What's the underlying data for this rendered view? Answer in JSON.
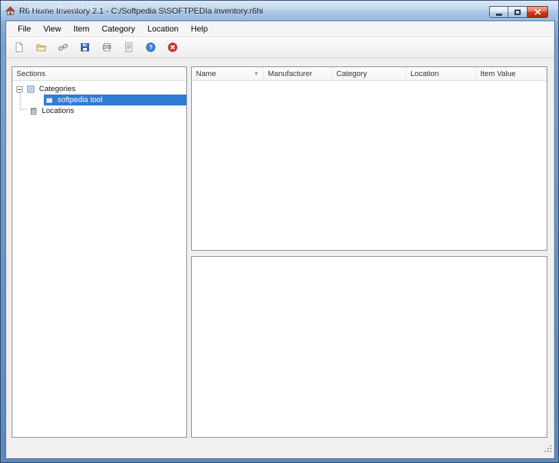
{
  "window": {
    "title": "R6 Home Inventory 2.1 - C:/Softpedia S\\SOFTPEDIa inventory.r6hi",
    "watermark": "www.softpedia.com",
    "controls": [
      {
        "name": "minimize"
      },
      {
        "name": "maximize"
      },
      {
        "name": "close"
      }
    ]
  },
  "menubar": {
    "items": [
      {
        "label": "File"
      },
      {
        "label": "View"
      },
      {
        "label": "Item"
      },
      {
        "label": "Category"
      },
      {
        "label": "Location"
      },
      {
        "label": "Help"
      }
    ]
  },
  "toolbar": {
    "buttons": [
      {
        "icon": "new-document-icon"
      },
      {
        "icon": "open-folder-icon"
      },
      {
        "icon": "link-icon"
      },
      {
        "icon": "save-icon"
      },
      {
        "icon": "print-icon"
      },
      {
        "icon": "report-icon"
      },
      {
        "icon": "help-icon"
      },
      {
        "icon": "exit-icon"
      }
    ]
  },
  "sidebar": {
    "header": "Sections",
    "items": [
      {
        "label": "Categories",
        "icon": "categories-icon",
        "expanded": true
      },
      {
        "label": "softpedia tool",
        "icon": "item-icon",
        "selected": true
      },
      {
        "label": "Locations",
        "icon": "locations-icon"
      }
    ]
  },
  "items_table": {
    "columns": [
      {
        "label": "Name",
        "sorted": true
      },
      {
        "label": "Manufacturer"
      },
      {
        "label": "Category"
      },
      {
        "label": "Location"
      },
      {
        "label": "Item Value"
      }
    ],
    "sort_indicator": "▼",
    "rows": []
  },
  "colors": {
    "selection": "#2f7cd6",
    "frame": "#6b96c6",
    "close_button": "#cc3a1d"
  }
}
